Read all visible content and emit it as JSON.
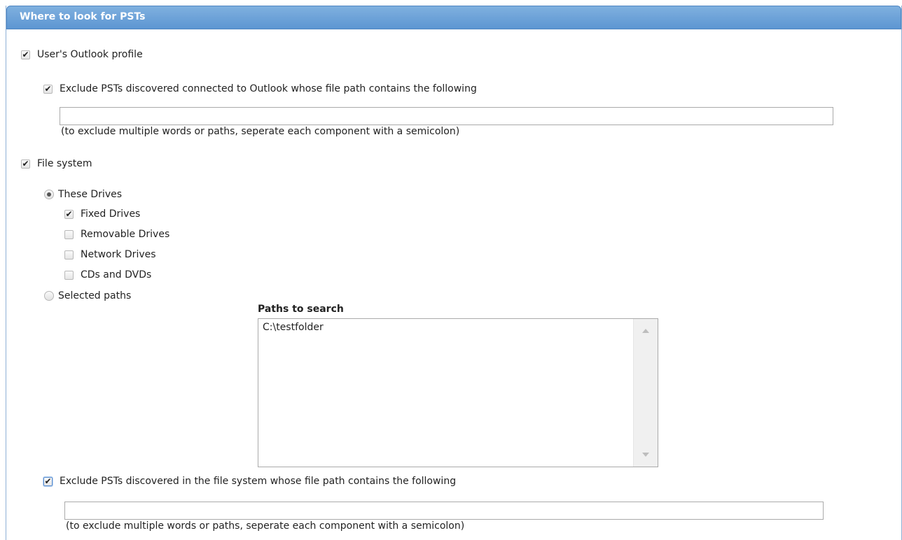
{
  "header": {
    "title": "Where to look for PSTs"
  },
  "outlook": {
    "checkbox_label": "User's Outlook profile",
    "exclude_label": "Exclude PSTs discovered connected to Outlook whose file path contains the following",
    "exclude_value": "",
    "hint": "(to exclude multiple words or paths, seperate each component with a semicolon)"
  },
  "filesystem": {
    "checkbox_label": "File system",
    "these_drives_label": "These Drives",
    "drives": [
      {
        "label": "Fixed Drives",
        "checked": true
      },
      {
        "label": "Removable Drives",
        "checked": false
      },
      {
        "label": "Network Drives",
        "checked": false
      },
      {
        "label": "CDs and DVDs",
        "checked": false
      }
    ],
    "selected_paths_label": "Selected paths",
    "paths_label": "Paths to search",
    "paths": [
      "C:\\testfolder"
    ],
    "exclude_label": "Exclude PSTs discovered in the file system whose file path contains the following",
    "exclude_value": "",
    "hint": "(to exclude multiple words or paths, seperate each component with a semicolon)"
  },
  "colors": {
    "header": "#5d96d2",
    "header_text": "#ffffff"
  },
  "icons": {
    "check": "check-icon",
    "radio": "radio-dot-icon"
  }
}
